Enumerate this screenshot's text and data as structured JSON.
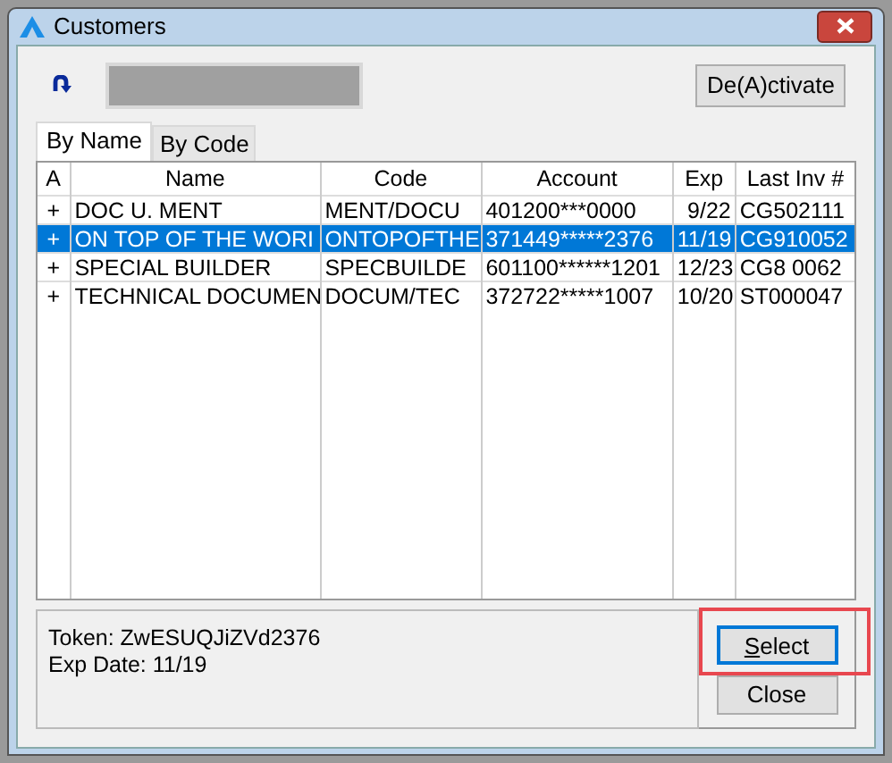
{
  "window": {
    "title": "Customers"
  },
  "deactivate_button": "De(A)ctivate",
  "tabs": [
    {
      "label": "By Name",
      "selected": true
    },
    {
      "label": "By Code",
      "selected": false
    }
  ],
  "table": {
    "columns": [
      "A",
      "Name",
      "Code",
      "Account",
      "Exp",
      "Last Inv #"
    ],
    "rows": [
      {
        "cells": [
          "+",
          "DOC U. MENT",
          "MENT/DOCU",
          "401200***0000",
          "9/22",
          "CG502111"
        ],
        "selected": false
      },
      {
        "cells": [
          "+",
          "ON TOP OF THE WORI",
          "ONTOPOFTHE",
          "371449*****2376",
          "11/19",
          "CG910052"
        ],
        "selected": true
      },
      {
        "cells": [
          "+",
          "SPECIAL BUILDER",
          "SPECBUILDE",
          "601100******1201",
          "12/23",
          "CG8 0062"
        ],
        "selected": false
      },
      {
        "cells": [
          "+",
          "TECHNICAL DOCUMEN",
          "DOCUM/TEC",
          "372722*****1007",
          "10/20",
          "ST000047"
        ],
        "selected": false
      }
    ]
  },
  "details": [
    "Token: ZwESUQJiZVd2376",
    "Exp Date: 11/19"
  ],
  "buttons": [
    {
      "label": "Select",
      "focused": true,
      "highlighted": true,
      "mnemonic_shown": true
    },
    {
      "label": "Close",
      "focused": false,
      "highlighted": false,
      "mnemonic_shown": false
    }
  ]
}
